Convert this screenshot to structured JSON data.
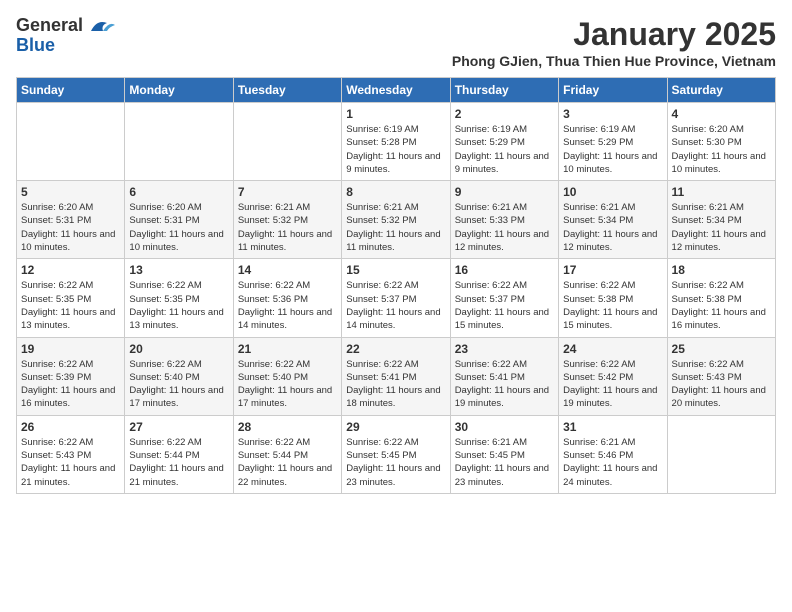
{
  "header": {
    "logo_general": "General",
    "logo_blue": "Blue",
    "month_title": "January 2025",
    "subtitle": "Phong GJien, Thua Thien Hue Province, Vietnam"
  },
  "weekdays": [
    "Sunday",
    "Monday",
    "Tuesday",
    "Wednesday",
    "Thursday",
    "Friday",
    "Saturday"
  ],
  "weeks": [
    [
      {
        "day": "",
        "sunrise": "",
        "sunset": "",
        "daylight": ""
      },
      {
        "day": "",
        "sunrise": "",
        "sunset": "",
        "daylight": ""
      },
      {
        "day": "",
        "sunrise": "",
        "sunset": "",
        "daylight": ""
      },
      {
        "day": "1",
        "sunrise": "Sunrise: 6:19 AM",
        "sunset": "Sunset: 5:28 PM",
        "daylight": "Daylight: 11 hours and 9 minutes."
      },
      {
        "day": "2",
        "sunrise": "Sunrise: 6:19 AM",
        "sunset": "Sunset: 5:29 PM",
        "daylight": "Daylight: 11 hours and 9 minutes."
      },
      {
        "day": "3",
        "sunrise": "Sunrise: 6:19 AM",
        "sunset": "Sunset: 5:29 PM",
        "daylight": "Daylight: 11 hours and 10 minutes."
      },
      {
        "day": "4",
        "sunrise": "Sunrise: 6:20 AM",
        "sunset": "Sunset: 5:30 PM",
        "daylight": "Daylight: 11 hours and 10 minutes."
      }
    ],
    [
      {
        "day": "5",
        "sunrise": "Sunrise: 6:20 AM",
        "sunset": "Sunset: 5:31 PM",
        "daylight": "Daylight: 11 hours and 10 minutes."
      },
      {
        "day": "6",
        "sunrise": "Sunrise: 6:20 AM",
        "sunset": "Sunset: 5:31 PM",
        "daylight": "Daylight: 11 hours and 10 minutes."
      },
      {
        "day": "7",
        "sunrise": "Sunrise: 6:21 AM",
        "sunset": "Sunset: 5:32 PM",
        "daylight": "Daylight: 11 hours and 11 minutes."
      },
      {
        "day": "8",
        "sunrise": "Sunrise: 6:21 AM",
        "sunset": "Sunset: 5:32 PM",
        "daylight": "Daylight: 11 hours and 11 minutes."
      },
      {
        "day": "9",
        "sunrise": "Sunrise: 6:21 AM",
        "sunset": "Sunset: 5:33 PM",
        "daylight": "Daylight: 11 hours and 12 minutes."
      },
      {
        "day": "10",
        "sunrise": "Sunrise: 6:21 AM",
        "sunset": "Sunset: 5:34 PM",
        "daylight": "Daylight: 11 hours and 12 minutes."
      },
      {
        "day": "11",
        "sunrise": "Sunrise: 6:21 AM",
        "sunset": "Sunset: 5:34 PM",
        "daylight": "Daylight: 11 hours and 12 minutes."
      }
    ],
    [
      {
        "day": "12",
        "sunrise": "Sunrise: 6:22 AM",
        "sunset": "Sunset: 5:35 PM",
        "daylight": "Daylight: 11 hours and 13 minutes."
      },
      {
        "day": "13",
        "sunrise": "Sunrise: 6:22 AM",
        "sunset": "Sunset: 5:35 PM",
        "daylight": "Daylight: 11 hours and 13 minutes."
      },
      {
        "day": "14",
        "sunrise": "Sunrise: 6:22 AM",
        "sunset": "Sunset: 5:36 PM",
        "daylight": "Daylight: 11 hours and 14 minutes."
      },
      {
        "day": "15",
        "sunrise": "Sunrise: 6:22 AM",
        "sunset": "Sunset: 5:37 PM",
        "daylight": "Daylight: 11 hours and 14 minutes."
      },
      {
        "day": "16",
        "sunrise": "Sunrise: 6:22 AM",
        "sunset": "Sunset: 5:37 PM",
        "daylight": "Daylight: 11 hours and 15 minutes."
      },
      {
        "day": "17",
        "sunrise": "Sunrise: 6:22 AM",
        "sunset": "Sunset: 5:38 PM",
        "daylight": "Daylight: 11 hours and 15 minutes."
      },
      {
        "day": "18",
        "sunrise": "Sunrise: 6:22 AM",
        "sunset": "Sunset: 5:38 PM",
        "daylight": "Daylight: 11 hours and 16 minutes."
      }
    ],
    [
      {
        "day": "19",
        "sunrise": "Sunrise: 6:22 AM",
        "sunset": "Sunset: 5:39 PM",
        "daylight": "Daylight: 11 hours and 16 minutes."
      },
      {
        "day": "20",
        "sunrise": "Sunrise: 6:22 AM",
        "sunset": "Sunset: 5:40 PM",
        "daylight": "Daylight: 11 hours and 17 minutes."
      },
      {
        "day": "21",
        "sunrise": "Sunrise: 6:22 AM",
        "sunset": "Sunset: 5:40 PM",
        "daylight": "Daylight: 11 hours and 17 minutes."
      },
      {
        "day": "22",
        "sunrise": "Sunrise: 6:22 AM",
        "sunset": "Sunset: 5:41 PM",
        "daylight": "Daylight: 11 hours and 18 minutes."
      },
      {
        "day": "23",
        "sunrise": "Sunrise: 6:22 AM",
        "sunset": "Sunset: 5:41 PM",
        "daylight": "Daylight: 11 hours and 19 minutes."
      },
      {
        "day": "24",
        "sunrise": "Sunrise: 6:22 AM",
        "sunset": "Sunset: 5:42 PM",
        "daylight": "Daylight: 11 hours and 19 minutes."
      },
      {
        "day": "25",
        "sunrise": "Sunrise: 6:22 AM",
        "sunset": "Sunset: 5:43 PM",
        "daylight": "Daylight: 11 hours and 20 minutes."
      }
    ],
    [
      {
        "day": "26",
        "sunrise": "Sunrise: 6:22 AM",
        "sunset": "Sunset: 5:43 PM",
        "daylight": "Daylight: 11 hours and 21 minutes."
      },
      {
        "day": "27",
        "sunrise": "Sunrise: 6:22 AM",
        "sunset": "Sunset: 5:44 PM",
        "daylight": "Daylight: 11 hours and 21 minutes."
      },
      {
        "day": "28",
        "sunrise": "Sunrise: 6:22 AM",
        "sunset": "Sunset: 5:44 PM",
        "daylight": "Daylight: 11 hours and 22 minutes."
      },
      {
        "day": "29",
        "sunrise": "Sunrise: 6:22 AM",
        "sunset": "Sunset: 5:45 PM",
        "daylight": "Daylight: 11 hours and 23 minutes."
      },
      {
        "day": "30",
        "sunrise": "Sunrise: 6:21 AM",
        "sunset": "Sunset: 5:45 PM",
        "daylight": "Daylight: 11 hours and 23 minutes."
      },
      {
        "day": "31",
        "sunrise": "Sunrise: 6:21 AM",
        "sunset": "Sunset: 5:46 PM",
        "daylight": "Daylight: 11 hours and 24 minutes."
      },
      {
        "day": "",
        "sunrise": "",
        "sunset": "",
        "daylight": ""
      }
    ]
  ]
}
